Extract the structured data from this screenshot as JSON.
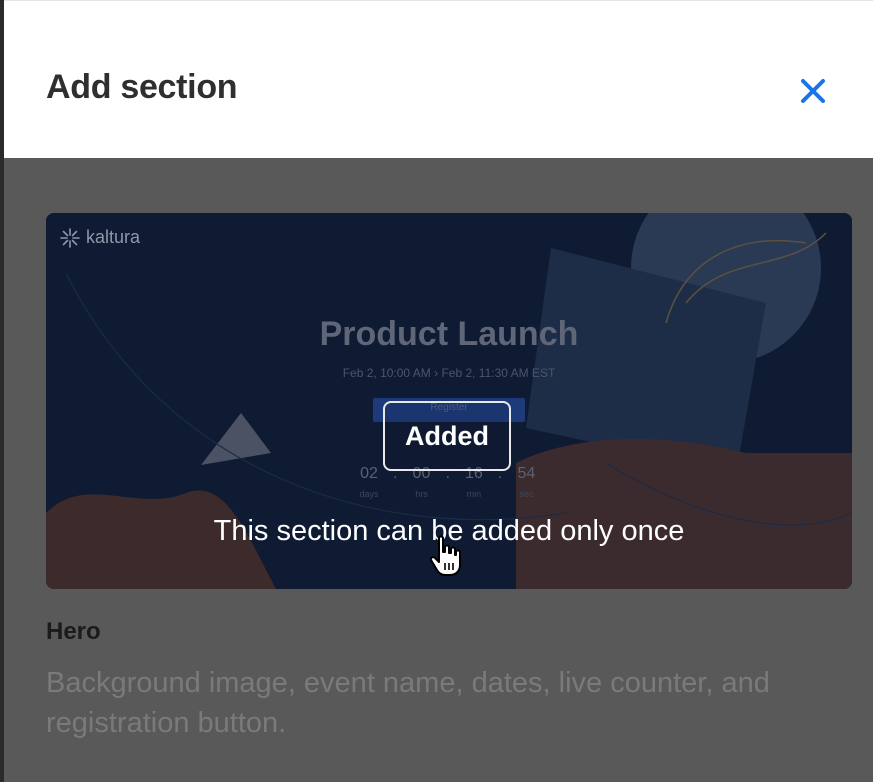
{
  "dialog": {
    "title": "Add section",
    "close_icon": "close-icon"
  },
  "section": {
    "name": "Hero",
    "description": "Background image, event name, dates, live counter, and registration button.",
    "status_badge": "Added",
    "status_message": "This section can be added only once"
  },
  "preview": {
    "logo_text": "kaltura",
    "event_title": "Product Launch",
    "dates": "Feb 2, 10:00 AM  ›  Feb 2, 11:30 AM  EST",
    "register_label": "Register",
    "countdown": [
      {
        "value": "02",
        "label": "days"
      },
      {
        "value": "00",
        "label": "hrs"
      },
      {
        "value": "16",
        "label": "min"
      },
      {
        "value": "54",
        "label": "sec"
      }
    ]
  },
  "colors": {
    "accent": "#1a73e8",
    "overlay": "#595959",
    "title_text": "#2f2f2f"
  }
}
